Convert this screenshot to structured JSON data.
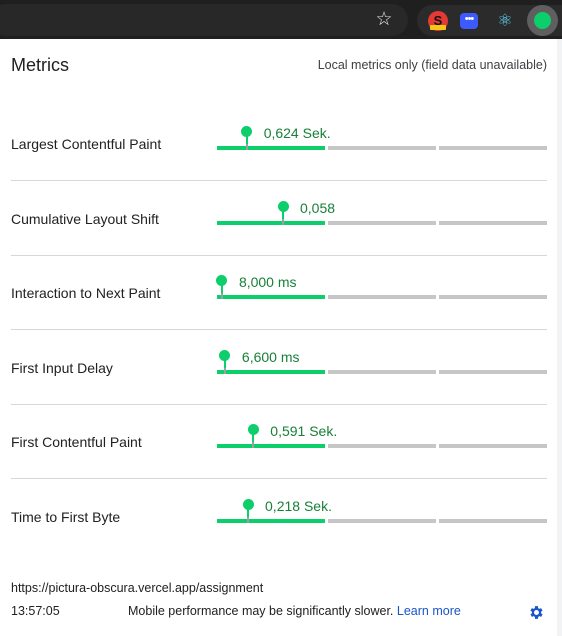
{
  "browser": {
    "star_icon": "star-icon",
    "extensions": [
      {
        "name": "s-extension-icon",
        "letter": "S"
      },
      {
        "name": "dots-extension-icon",
        "glyph": "•••"
      },
      {
        "name": "react-devtools-icon",
        "glyph": "⚛"
      },
      {
        "name": "web-vitals-extension-icon"
      }
    ]
  },
  "panel": {
    "title": "Metrics",
    "subtitle": "Local metrics only (field data unavailable)",
    "metrics": [
      {
        "name": "Largest Contentful Paint",
        "value": "0,624 Sek.",
        "position": 0.09
      },
      {
        "name": "Cumulative Layout Shift",
        "value": "0,058",
        "position": 0.2
      },
      {
        "name": "Interaction to Next Paint",
        "value": "8,000 ms",
        "position": 0.015
      },
      {
        "name": "First Input Delay",
        "value": "6,600 ms",
        "position": 0.024
      },
      {
        "name": "First Contentful Paint",
        "value": "0,591 Sek.",
        "position": 0.11
      },
      {
        "name": "Time to First Byte",
        "value": "0,218 Sek.",
        "position": 0.094
      }
    ],
    "footer": {
      "url": "https://pictura-obscura.vercel.app/assignment",
      "time": "13:57:05",
      "note": "Mobile performance may be significantly slower.",
      "learn_more": "Learn more"
    },
    "colors": {
      "good": "#0cce6b",
      "value_text": "#188038",
      "link": "#1a55c9"
    }
  }
}
